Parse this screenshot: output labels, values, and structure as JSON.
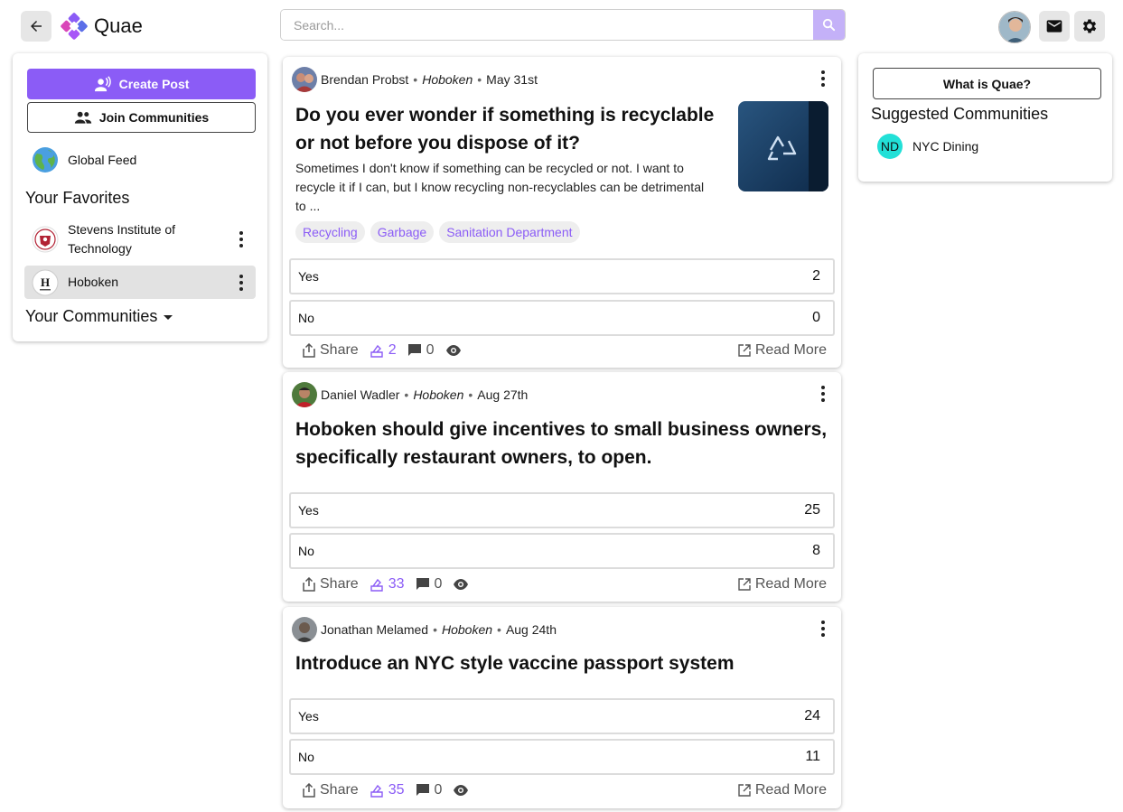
{
  "app": {
    "name": "Quae"
  },
  "search": {
    "placeholder": "Search..."
  },
  "colors": {
    "accent": "#8b5cf6",
    "accent_light": "#c4b1f8",
    "selected_bg": "#e6e6e6",
    "suggest_avatar": "#22e0d7"
  },
  "topbar": {
    "icons": [
      "arrow-left-icon",
      "quae-logo",
      "search-icon",
      "user-avatar",
      "mail-icon",
      "gear-icon"
    ]
  },
  "sidebar": {
    "create_post": "Create Post",
    "join_communities": "Join Communities",
    "global_feed": "Global Feed",
    "favorites_heading": "Your Favorites",
    "favorites": [
      {
        "name": "Stevens Institute of Technology",
        "selected": false
      },
      {
        "name": "Hoboken",
        "selected": true
      }
    ],
    "communities_heading": "Your Communities"
  },
  "posts": [
    {
      "author": "Brendan Probst",
      "community": "Hoboken",
      "date": "May 31st",
      "title_line1": "Do you ever wonder if something is recyclable",
      "title_line2": "or not before you dispose of it?",
      "body_line1": "Sometimes I don't know if something can be recycled or not. I want to",
      "body_line2": "recycle it if I can, but I know recycling non-recyclables can be detrimental",
      "body_line3": "to ...",
      "has_image": true,
      "tags": [
        "Recycling",
        "Garbage",
        "Sanitation Department"
      ],
      "options": [
        {
          "label": "Yes",
          "count": "2"
        },
        {
          "label": "No",
          "count": "0"
        }
      ],
      "share": "Share",
      "votes": "2",
      "comments": "0",
      "read_more": "Read More"
    },
    {
      "author": "Daniel Wadler",
      "community": "Hoboken",
      "date": "Aug 27th",
      "title_line1": "Hoboken should give incentives to small business owners,",
      "title_line2": "specifically restaurant owners, to open.",
      "options": [
        {
          "label": "Yes",
          "count": "25"
        },
        {
          "label": "No",
          "count": "8"
        }
      ],
      "share": "Share",
      "votes": "33",
      "comments": "0",
      "read_more": "Read More"
    },
    {
      "author": "Jonathan Melamed",
      "community": "Hoboken",
      "date": "Aug 24th",
      "title_line1": "Introduce an NYC style vaccine passport system",
      "options": [
        {
          "label": "Yes",
          "count": "24"
        },
        {
          "label": "No",
          "count": "11"
        }
      ],
      "share": "Share",
      "votes": "35",
      "comments": "0",
      "read_more": "Read More"
    }
  ],
  "right": {
    "what_is": "What is Quae?",
    "suggested_heading": "Suggested Communities",
    "suggested": [
      {
        "initials": "ND",
        "name": "NYC Dining"
      }
    ]
  }
}
